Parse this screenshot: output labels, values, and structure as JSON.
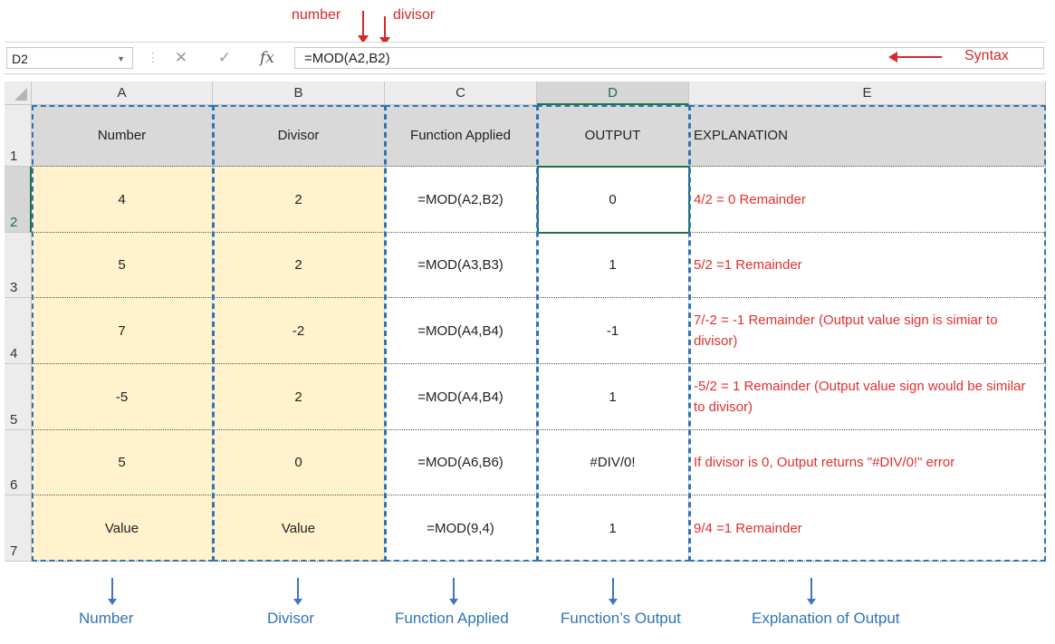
{
  "annotations": {
    "number_label": "number",
    "divisor_label": "divisor",
    "syntax_label": "Syntax"
  },
  "formula_bar": {
    "name_box": "D2",
    "cancel_icon": "✕",
    "enter_icon": "✓",
    "fx_label": "fx",
    "formula": "=MOD(A2,B2)"
  },
  "columns": [
    "A",
    "B",
    "C",
    "D",
    "E"
  ],
  "rows": [
    {
      "num": "1",
      "a": "Number",
      "b": "Divisor",
      "c": "Function Applied",
      "d": "OUTPUT",
      "e": "EXPLANATION"
    },
    {
      "num": "2",
      "a": "4",
      "b": "2",
      "c": "=MOD(A2,B2)",
      "d": "0",
      "e": "4/2 = 0 Remainder"
    },
    {
      "num": "3",
      "a": "5",
      "b": "2",
      "c": "=MOD(A3,B3)",
      "d": "1",
      "e": "5/2 =1 Remainder"
    },
    {
      "num": "4",
      "a": "7",
      "b": "-2",
      "c": "=MOD(A4,B4)",
      "d": "-1",
      "e": "7/-2 = -1 Remainder (Output value sign is simiar to divisor)"
    },
    {
      "num": "5",
      "a": "-5",
      "b": "2",
      "c": "=MOD(A4,B4)",
      "d": "1",
      "e": "-5/2 = 1 Remainder (Output value sign would be similar to divisor)"
    },
    {
      "num": "6",
      "a": "5",
      "b": "0",
      "c": "=MOD(A6,B6)",
      "d": "#DIV/0!",
      "e": "If divisor is 0, Output returns \"#DIV/0!\" error"
    },
    {
      "num": "7",
      "a": "Value",
      "b": "Value",
      "c": "=MOD(9,4)",
      "d": "1",
      "e": "9/4 =1 Remainder"
    }
  ],
  "bottom_labels": {
    "number": "Number",
    "divisor": "Divisor",
    "function_applied": "Function Applied",
    "function_output": "Function’s Output",
    "explanation": "Explanation of Output"
  },
  "colors": {
    "accent_red": "#d42a2a",
    "accent_blue": "#2e75b6",
    "excel_green": "#217346",
    "tan_fill": "#fff2cc"
  }
}
